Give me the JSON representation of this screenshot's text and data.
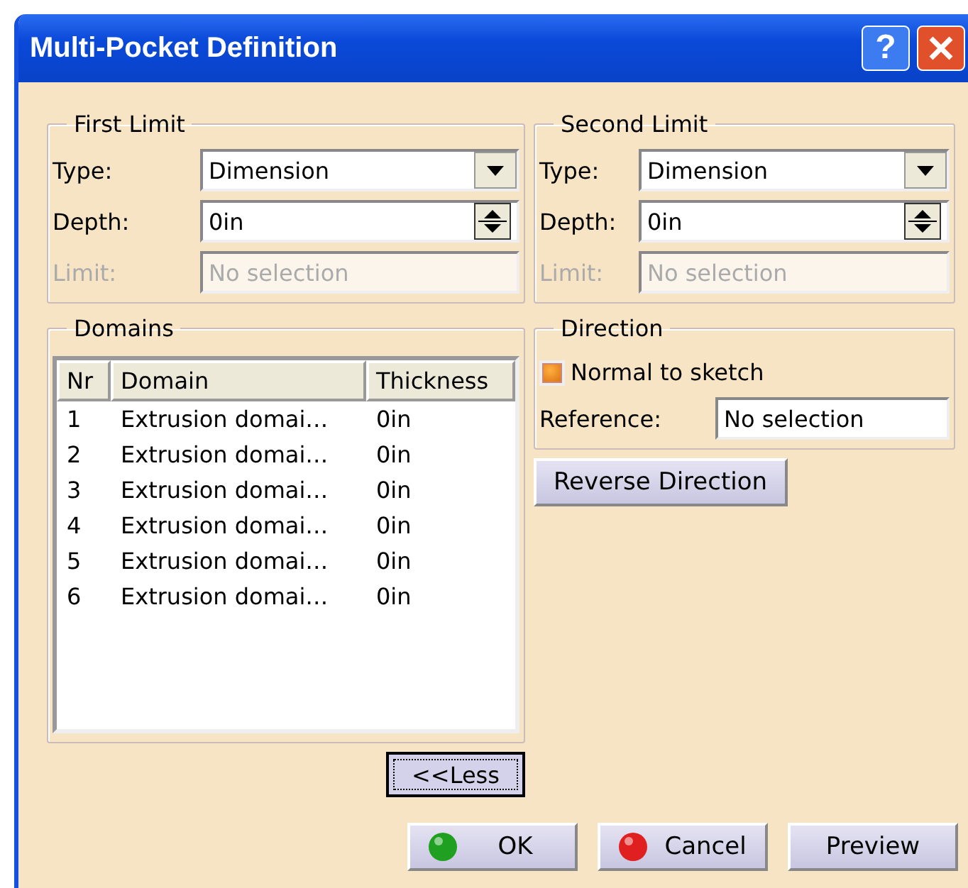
{
  "window": {
    "title": "Multi-Pocket Definition",
    "title_buttons": [
      {
        "kind": "help",
        "label": "?"
      },
      {
        "kind": "close"
      }
    ]
  },
  "first_limit": {
    "title": "First Limit",
    "type": {
      "label": "Type:",
      "value": "Dimension"
    },
    "depth": {
      "label": "Depth:",
      "value": "0in"
    },
    "limit": {
      "label": "Limit:",
      "value": "No selection",
      "disabled": true
    }
  },
  "second_limit": {
    "title": "Second Limit",
    "type": {
      "label": "Type:",
      "value": "Dimension"
    },
    "depth": {
      "label": "Depth:",
      "value": "0in"
    },
    "limit": {
      "label": "Limit:",
      "value": "No selection",
      "disabled": true
    }
  },
  "domains": {
    "title": "Domains",
    "columns": [
      "Nr",
      "Domain",
      "Thickness"
    ],
    "rows": [
      [
        "1",
        "Extrusion domai…",
        "0in"
      ],
      [
        "2",
        "Extrusion domai…",
        "0in"
      ],
      [
        "3",
        "Extrusion domai…",
        "0in"
      ],
      [
        "4",
        "Extrusion domai…",
        "0in"
      ],
      [
        "5",
        "Extrusion domai…",
        "0in"
      ],
      [
        "6",
        "Extrusion domai…",
        "0in"
      ]
    ]
  },
  "direction": {
    "title": "Direction",
    "normal_to_sketch": {
      "label": "Normal to sketch",
      "checked": true
    },
    "reference": {
      "label": "Reference:",
      "value": "No selection"
    }
  },
  "reverse_button": "Reverse Direction",
  "less_button": {
    "label": "<<Less",
    "focused": true
  },
  "buttons": [
    {
      "kind": "ok",
      "label": "OK"
    },
    {
      "kind": "cancel",
      "label": "Cancel"
    },
    {
      "kind": "plain",
      "label": "Preview"
    }
  ]
}
